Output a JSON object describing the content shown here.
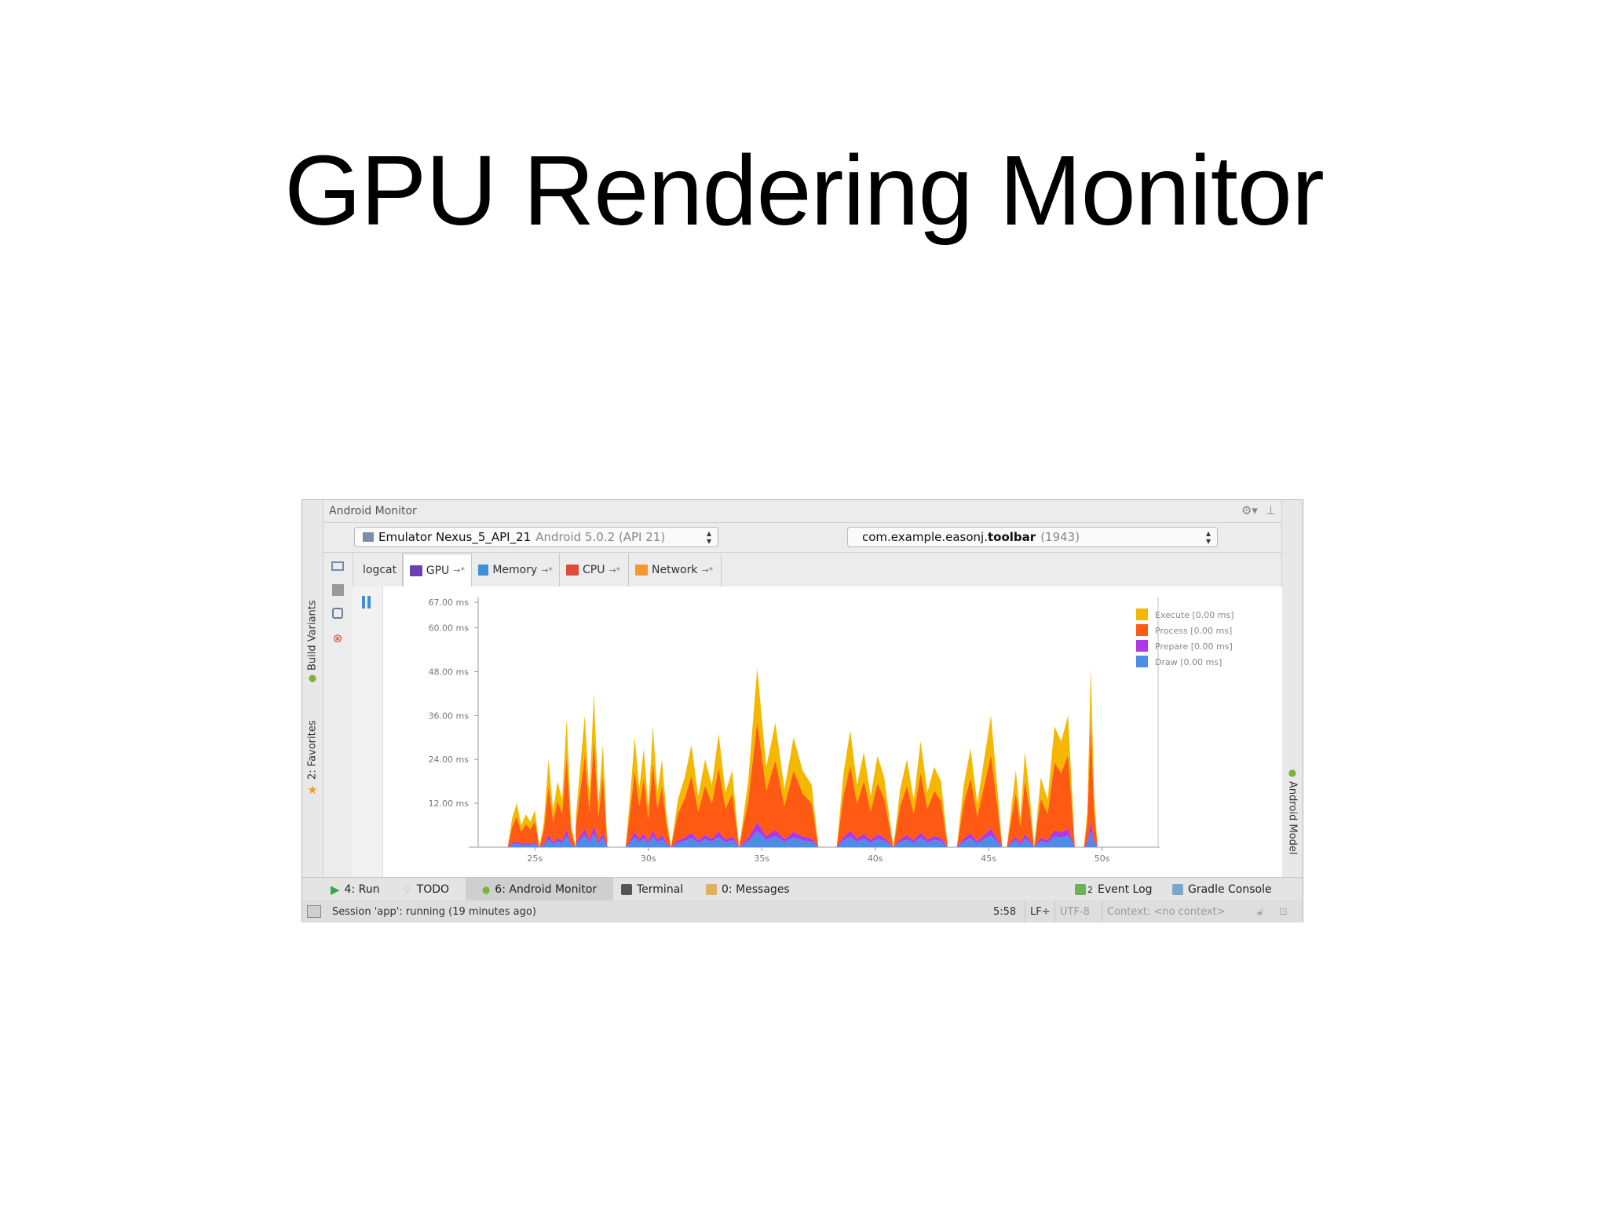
{
  "slide": {
    "title": "GPU Rendering Monitor"
  },
  "window": {
    "title": "Android Monitor",
    "header_icons": [
      "gear-icon",
      "hide-icon"
    ],
    "device_combo": {
      "name": "Emulator Nexus_5_API_21",
      "detail": "Android 5.0.2 (API 21)"
    },
    "process_combo": {
      "prefix": "com.example.easonj.",
      "bold": "toolbar",
      "pid": "(1943)"
    },
    "tabs": [
      {
        "label": "logcat",
        "icon": "logcat-icon",
        "color": "#d9a441",
        "pin": ""
      },
      {
        "label": "GPU",
        "icon": "gpu-icon",
        "color": "#6b3fb5",
        "pin": "→*",
        "active": true
      },
      {
        "label": "Memory",
        "icon": "memory-icon",
        "color": "#3d8fd6",
        "pin": "→*"
      },
      {
        "label": "CPU",
        "icon": "cpu-icon",
        "color": "#e04a3a",
        "pin": "→*"
      },
      {
        "label": "Network",
        "icon": "network-icon",
        "color": "#f29a2e",
        "pin": "→*"
      }
    ],
    "left_tools": [
      "screenshot-icon",
      "stop-icon",
      "screen-record-icon",
      "close-circle-icon"
    ],
    "left_vertical_tabs": [
      {
        "label": "2: Favorites",
        "icon": "star-icon"
      },
      {
        "label": "Build Variants",
        "icon": "android-icon"
      }
    ],
    "right_vertical_tabs": [
      {
        "label": "Android Model",
        "icon": "android-icon"
      }
    ],
    "bottom_tools": [
      {
        "label": "4: Run",
        "icon": "run-icon"
      },
      {
        "label": "TODO",
        "icon": "todo-icon"
      },
      {
        "label": "6: Android Monitor",
        "icon": "android-monitor-icon",
        "active": true
      },
      {
        "label": "Terminal",
        "icon": "terminal-icon"
      },
      {
        "label": "0: Messages",
        "icon": "messages-icon"
      },
      {
        "label": "Event Log",
        "icon": "event-log-icon",
        "badge": "2"
      },
      {
        "label": "Gradle Console",
        "icon": "gradle-icon"
      }
    ],
    "status": {
      "session": "Session 'app': running (19 minutes ago)",
      "position": "5:58",
      "line_sep": "LF÷",
      "encoding": "UTF-8",
      "context": "Context: <no context>"
    }
  },
  "colors": {
    "execute": "#f5b800",
    "process": "#ff5a14",
    "prepare": "#b036e8",
    "draw": "#4d8de8",
    "accent": "#3d8fd6"
  },
  "chart_data": {
    "type": "area",
    "stacked": true,
    "y_tick_labels": [
      "12.00 ms",
      "24.00 ms",
      "36.00 ms",
      "48.00 ms",
      "60.00 ms",
      "67.00 ms"
    ],
    "y_ticks": [
      12,
      24,
      36,
      48,
      60,
      67
    ],
    "ylim": [
      0,
      67
    ],
    "x_tick_labels": [
      "25s",
      "30s",
      "35s",
      "40s",
      "45s",
      "50s"
    ],
    "x_ticks": [
      25,
      30,
      35,
      40,
      45,
      50
    ],
    "xlim": [
      22.5,
      51.5
    ],
    "legend_position": "top-right",
    "series": [
      {
        "name": "Draw [0.00 ms]",
        "color": "#4d8de8"
      },
      {
        "name": "Prepare [0.00 ms]",
        "color": "#b036e8"
      },
      {
        "name": "Process [0.00 ms]",
        "color": "#ff5a14"
      },
      {
        "name": "Execute [0.00 ms]",
        "color": "#f5b800"
      }
    ],
    "legend": [
      "Execute [0.00 ms]",
      "Process [0.00 ms]",
      "Prepare [0.00 ms]",
      "Draw [0.00 ms]"
    ],
    "segments": [
      {
        "start": 23.8,
        "end": 25.2,
        "x": [
          23.8,
          24.0,
          24.2,
          24.4,
          24.6,
          24.8,
          25.0,
          25.2
        ],
        "total": [
          0,
          8,
          12,
          6,
          9,
          7,
          10,
          0
        ]
      },
      {
        "start": 25.2,
        "end": 26.8,
        "x": [
          25.2,
          25.4,
          25.6,
          25.8,
          26.0,
          26.2,
          26.4,
          26.6,
          26.8
        ],
        "total": [
          0,
          7,
          24,
          10,
          18,
          13,
          35,
          6,
          0
        ]
      },
      {
        "start": 26.8,
        "end": 28.3,
        "x": [
          26.8,
          27.0,
          27.2,
          27.4,
          27.6,
          27.8,
          28.0,
          28.2
        ],
        "total": [
          8,
          22,
          36,
          14,
          42,
          12,
          28,
          0
        ]
      },
      {
        "start": 29.0,
        "end": 31.0,
        "x": [
          29.0,
          29.2,
          29.4,
          29.6,
          29.8,
          30.0,
          30.2,
          30.4,
          30.6,
          30.8,
          31.0
        ],
        "total": [
          0,
          14,
          30,
          16,
          27,
          11,
          33,
          15,
          24,
          9,
          0
        ]
      },
      {
        "start": 31.0,
        "end": 34.0,
        "x": [
          31.0,
          31.3,
          31.6,
          31.9,
          32.2,
          32.5,
          32.8,
          33.1,
          33.4,
          33.7,
          34.0
        ],
        "total": [
          0,
          13,
          19,
          28,
          14,
          24,
          17,
          31,
          15,
          21,
          0
        ]
      },
      {
        "start": 34.0,
        "end": 37.5,
        "x": [
          34.0,
          34.4,
          34.8,
          35.2,
          35.6,
          36.0,
          36.4,
          36.8,
          37.2,
          37.5
        ],
        "total": [
          0,
          18,
          49,
          22,
          34,
          16,
          30,
          21,
          17,
          0
        ]
      },
      {
        "start": 38.3,
        "end": 40.8,
        "x": [
          38.3,
          38.6,
          38.9,
          39.2,
          39.5,
          39.8,
          40.1,
          40.4,
          40.8
        ],
        "total": [
          0,
          20,
          32,
          17,
          26,
          14,
          25,
          19,
          0
        ]
      },
      {
        "start": 40.8,
        "end": 43.2,
        "x": [
          40.8,
          41.1,
          41.4,
          41.7,
          42.0,
          42.3,
          42.6,
          42.9,
          43.2
        ],
        "total": [
          0,
          16,
          24,
          13,
          29,
          15,
          22,
          18,
          0
        ]
      },
      {
        "start": 43.6,
        "end": 45.6,
        "x": [
          43.6,
          43.9,
          44.2,
          44.5,
          44.8,
          45.1,
          45.4,
          45.6
        ],
        "total": [
          0,
          17,
          27,
          12,
          24,
          36,
          15,
          0
        ]
      },
      {
        "start": 45.8,
        "end": 47.0,
        "x": [
          45.8,
          46.0,
          46.2,
          46.4,
          46.6,
          46.8,
          47.0
        ],
        "total": [
          0,
          11,
          21,
          8,
          26,
          15,
          0
        ]
      },
      {
        "start": 47.0,
        "end": 48.8,
        "x": [
          47.0,
          47.3,
          47.6,
          47.9,
          48.2,
          48.5,
          48.8
        ],
        "total": [
          0,
          19,
          13,
          33,
          29,
          36,
          0
        ]
      },
      {
        "start": 49.2,
        "end": 49.8,
        "x": [
          49.2,
          49.35,
          49.5,
          49.65,
          49.8
        ],
        "total": [
          0,
          10,
          49,
          14,
          0
        ]
      }
    ],
    "stack_shares": {
      "draw": 0.09,
      "prepare": 0.05,
      "process": 0.56,
      "execute": 0.3
    }
  }
}
